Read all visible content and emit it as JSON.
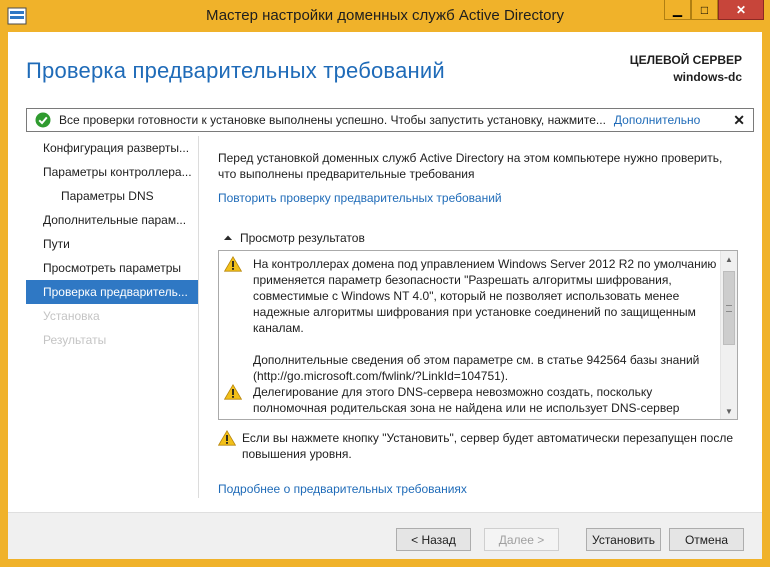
{
  "window": {
    "title": "Мастер настройки доменных служб Active Directory",
    "controls": {
      "minimize": "▁",
      "maximize": "□",
      "close": "✕"
    },
    "frame_color": "#f0b22a"
  },
  "header": {
    "page_title": "Проверка предварительных требований",
    "target_label": "ЦЕЛЕВОЙ СЕРВЕР",
    "target_value": "windows-dc"
  },
  "notification": {
    "icon": "success-check-icon",
    "text": "Все проверки готовности к установке выполнены успешно.  Чтобы запустить установку, нажмите...",
    "link": "Дополнительно",
    "close": "✕"
  },
  "nav": {
    "items": [
      {
        "label": "Конфигурация разверты...",
        "state": "normal",
        "level": 0
      },
      {
        "label": "Параметры контроллера...",
        "state": "normal",
        "level": 0
      },
      {
        "label": "Параметры DNS",
        "state": "normal",
        "level": 1
      },
      {
        "label": "Дополнительные парам...",
        "state": "normal",
        "level": 0
      },
      {
        "label": "Пути",
        "state": "normal",
        "level": 0
      },
      {
        "label": "Просмотреть параметры",
        "state": "normal",
        "level": 0
      },
      {
        "label": "Проверка предваритель...",
        "state": "active",
        "level": 0
      },
      {
        "label": "Установка",
        "state": "disabled",
        "level": 0
      },
      {
        "label": "Результаты",
        "state": "disabled",
        "level": 0
      }
    ]
  },
  "content": {
    "intro_line1": "Перед установкой доменных служб Active Directory на этом компьютере нужно проверить,",
    "intro_line2": "что выполнены предварительные требования",
    "rerun_link": "Повторить проверку предварительных требований",
    "results_header": "Просмотр результатов",
    "messages": [
      {
        "icon": "warning-icon",
        "lines": [
          "На контроллерах домена под управлением Windows Server 2012 R2 по умолчанию",
          "применяется параметр безопасности \"Разрешать алгоритмы шифрования,",
          "совместимые с Windows NT 4.0\", который не позволяет использовать менее",
          "надежные алгоритмы шифрования при установке соединений по защищенным",
          "каналам.",
          "",
          "Дополнительные сведения об этом параметре см. в статье 942564 базы знаний",
          "(http://go.microsoft.com/fwlink/?LinkId=104751)."
        ]
      },
      {
        "icon": "warning-icon",
        "lines": [
          "Делегирование для этого DNS-сервера невозможно создать, поскольку",
          "полномочная родительская зона не найдена или не использует DNS-сервер"
        ]
      }
    ],
    "restart_note_line1": "Если вы нажмете кнопку \"Установить\", сервер будет автоматически перезапущен после",
    "restart_note_line2": "повышения уровня.",
    "more_link": "Подробнее о предварительных требованиях"
  },
  "footer": {
    "back": "< Назад",
    "next": "Далее >",
    "install": "Установить",
    "cancel": "Отмена"
  }
}
